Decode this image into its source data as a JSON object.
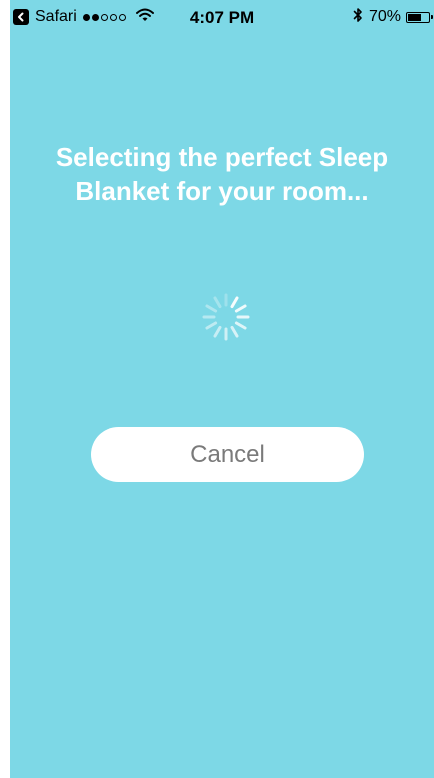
{
  "status_bar": {
    "carrier": "Safari",
    "time": "4:07 PM",
    "battery_percent": "70%",
    "battery_level": 0.7,
    "signal_bars_full": 2,
    "signal_bars_total": 5
  },
  "main": {
    "headline": "Selecting the perfect Sleep Blanket for your room...",
    "cancel_label": "Cancel"
  },
  "colors": {
    "background": "#7dd8e6",
    "headline_text": "#ffffff",
    "button_background": "#ffffff",
    "button_text": "#7a7a7a"
  },
  "icons": {
    "back": "back-to-app-icon",
    "signal": "cellular-signal-icon",
    "wifi": "wifi-icon",
    "bluetooth": "bluetooth-icon",
    "battery": "battery-icon",
    "spinner": "loading-spinner-icon"
  }
}
